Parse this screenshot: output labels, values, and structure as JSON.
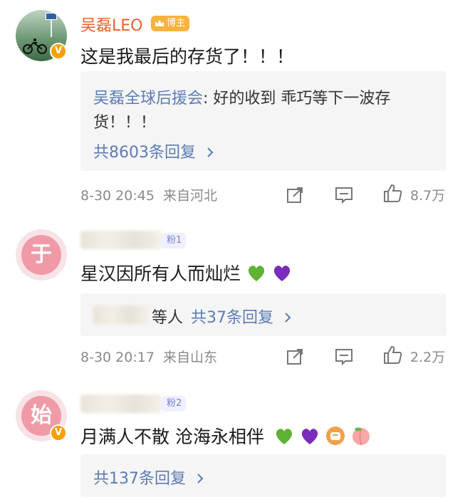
{
  "comments": [
    {
      "username": "吴磊LEO",
      "badge": "博主",
      "text": "这是我最后的存货了！！！",
      "reply": {
        "name": "吴磊全球后援会",
        "line1": ": 好的收到   乖巧等下一波存",
        "line2": "货！！！",
        "count": "共8603条回复"
      },
      "time": "8-30 20:45",
      "location": "来自河北",
      "likes": "8.7万"
    },
    {
      "badge": "粉1",
      "text": "星汉因所有人而灿烂",
      "reply": {
        "suffix": "等人",
        "count": "共37条回复"
      },
      "time": "8-30 20:17",
      "location": "来自山东",
      "likes": "2.2万"
    },
    {
      "badge": "粉2",
      "text": "月满人不散 沧海永相伴",
      "reply": {
        "count": "共137条回复"
      }
    }
  ],
  "icons": {
    "reply_arrow": "chevron-right-icon",
    "forward": "share-icon",
    "comment": "comment-icon",
    "like": "thumbs-up-icon"
  },
  "colors": {
    "username": "#e8622d",
    "reply_link": "#5b7cb5",
    "meta": "#8a8a8a",
    "reply_bg": "#f5f5f5"
  },
  "avatars": {
    "second": "于",
    "third": "始"
  }
}
